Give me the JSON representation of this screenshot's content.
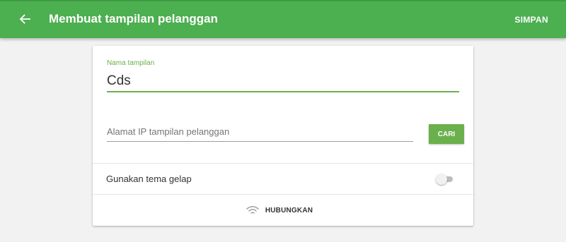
{
  "appbar": {
    "title": "Membuat tampilan pelanggan",
    "save_label": "SIMPAN",
    "back_icon": "arrow-back-icon",
    "color": "#4caf50"
  },
  "form": {
    "name_label": "Nama tampilan",
    "name_value": "Cds",
    "ip_placeholder": "Alamat IP tampilan pelanggan",
    "ip_value": "",
    "search_label": "CARI",
    "dark_theme_label": "Gunakan tema gelap",
    "dark_theme_enabled": false,
    "connect_label": "HUBUNGKAN",
    "connect_icon": "wifi-icon",
    "accent_color": "#6ab04c"
  }
}
